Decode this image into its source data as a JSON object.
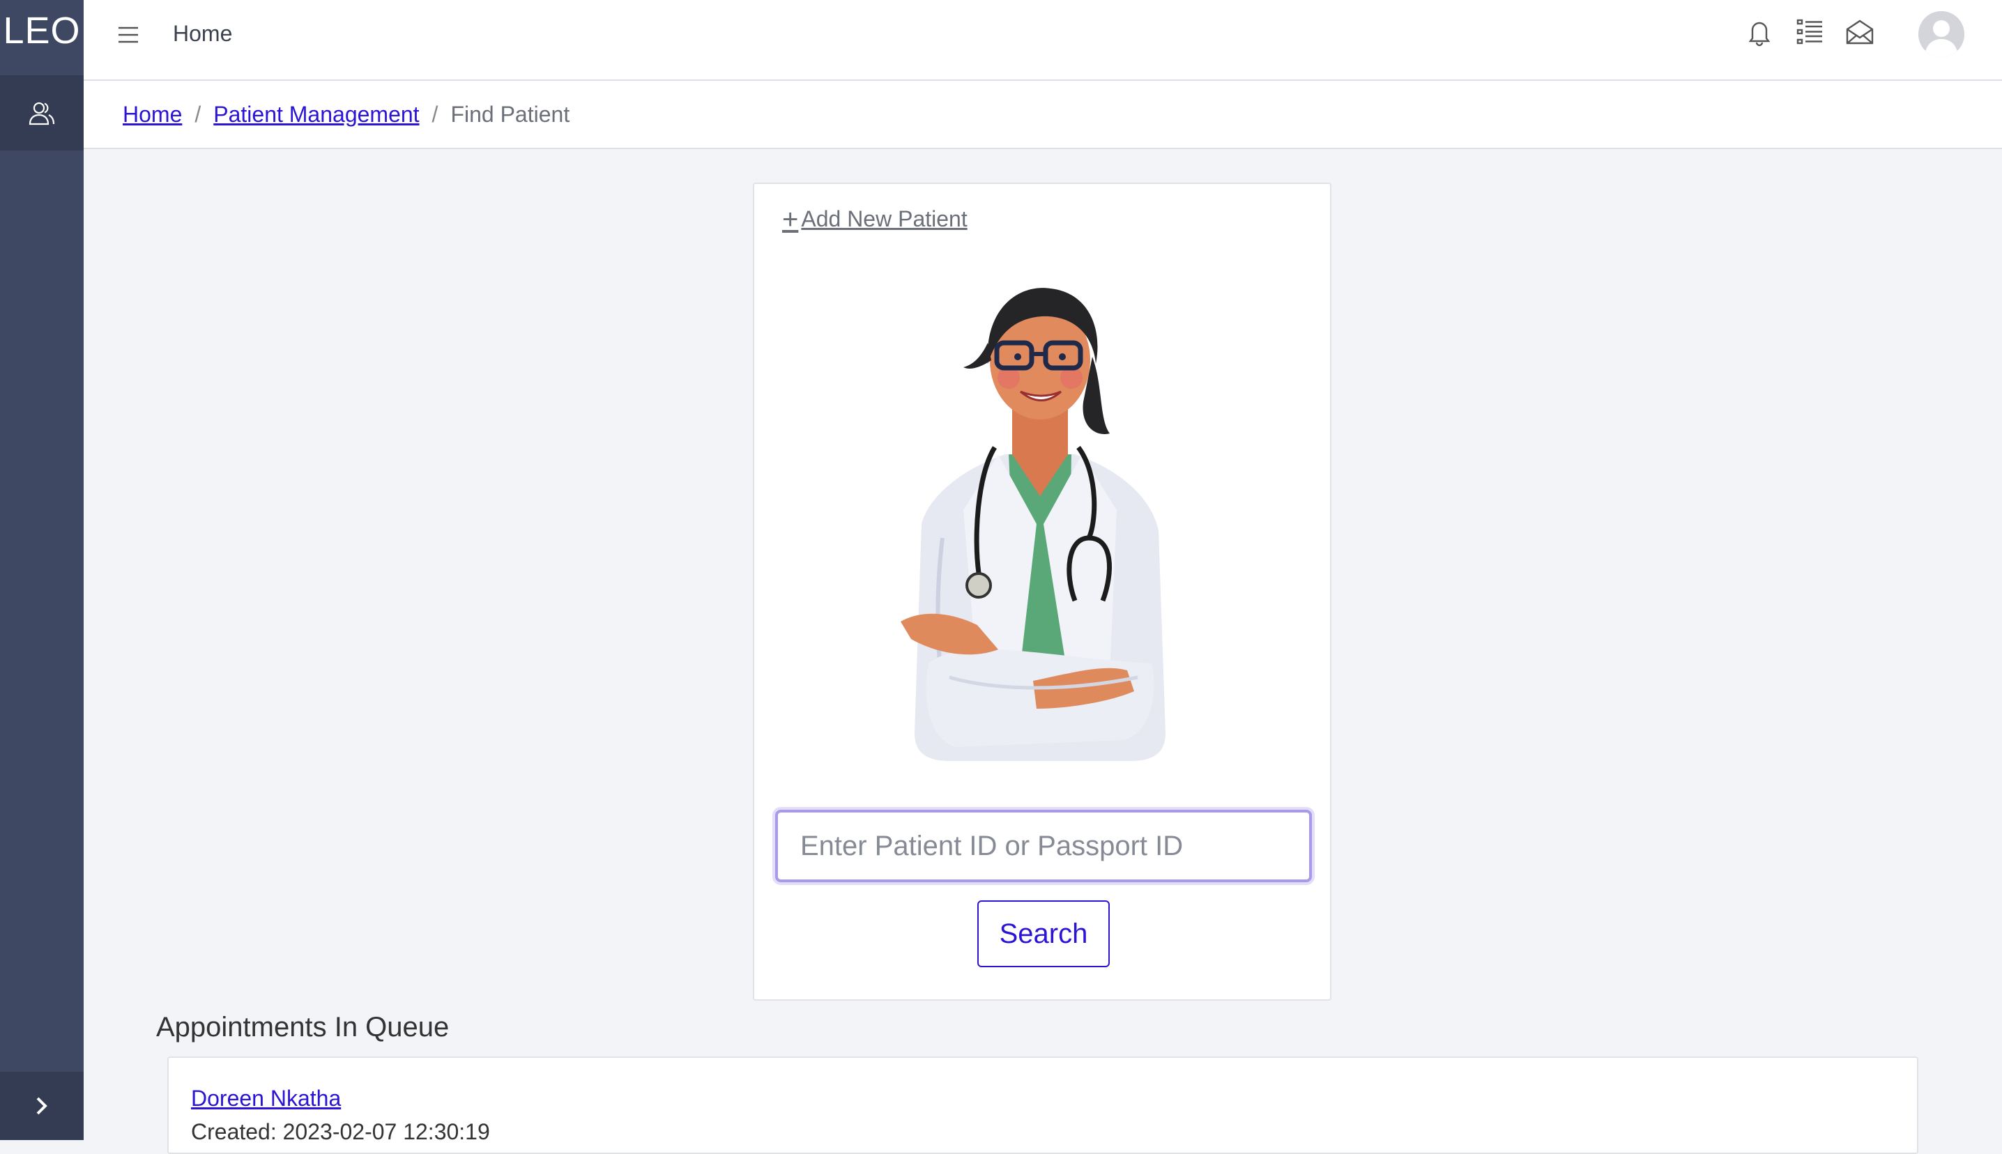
{
  "app": {
    "brand": "LEO"
  },
  "header": {
    "title": "Home"
  },
  "breadcrumb": {
    "home": "Home",
    "section": "Patient Management",
    "current": "Find Patient",
    "separator": "/"
  },
  "card": {
    "add_new_label": "Add New Patient",
    "search_placeholder": "Enter Patient ID or Passport ID",
    "search_value": "",
    "search_button": "Search"
  },
  "queue": {
    "title": "Appointments In Queue",
    "items": [
      {
        "name": "Doreen Nkatha",
        "created": "Created: 2023-02-07 12:30:19"
      }
    ]
  },
  "icons": {
    "sidebar": [
      "users-icon",
      "chevron-right-icon"
    ],
    "header": [
      "menu-icon",
      "bell-icon",
      "list-icon",
      "envelope-icon",
      "user-avatar"
    ]
  },
  "colors": {
    "sidebar": "#3e4863",
    "link": "#2b14d6",
    "focus": "#a89ae6"
  }
}
